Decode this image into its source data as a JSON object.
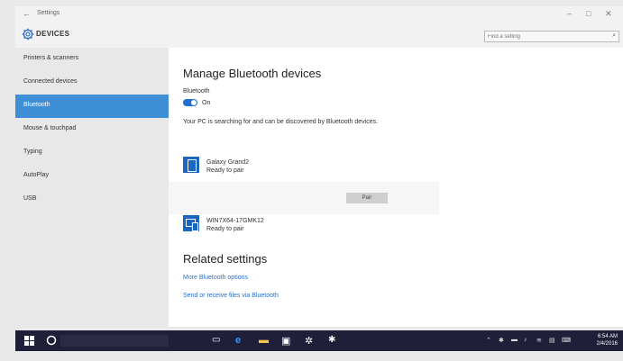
{
  "window": {
    "title": "Settings",
    "back_glyph": "←",
    "minimize_glyph": "–",
    "maximize_glyph": "□",
    "close_glyph": "✕"
  },
  "header": {
    "title": "DEVICES",
    "icon": "gear-icon",
    "search_placeholder": "Find a setting",
    "search_value": "",
    "search_icon_glyph": "⌕"
  },
  "sidebar": {
    "items": [
      {
        "label": "Printers & scanners",
        "active": false
      },
      {
        "label": "Connected devices",
        "active": false
      },
      {
        "label": "Bluetooth",
        "active": true
      },
      {
        "label": "Mouse & touchpad",
        "active": false
      },
      {
        "label": "Typing",
        "active": false
      },
      {
        "label": "AutoPlay",
        "active": false
      },
      {
        "label": "USB",
        "active": false
      }
    ]
  },
  "main": {
    "title": "Manage Bluetooth devices",
    "bluetooth_label": "Bluetooth",
    "toggle_state": "On",
    "status_text": "Your PC is searching for and can be discovered by Bluetooth devices.",
    "devices": [
      {
        "name": "Galaxy Grand2",
        "status": "Ready to pair",
        "icon": "phone-icon"
      },
      {
        "name": "WIN7X64-17GMK12",
        "status": "Ready to pair",
        "icon": "computer-icon"
      }
    ],
    "pair_label": "Pair",
    "related_title": "Related settings",
    "related_links": [
      "More Bluetooth options",
      "Send or receive files via Bluetooth"
    ]
  },
  "taskbar": {
    "start_icon": "windows-logo-icon",
    "search_icon": "cortana-icon",
    "pinned": [
      "task-view-icon",
      "edge-icon",
      "file-explorer-icon",
      "store-icon",
      "settings-icon",
      "bluetooth-icon"
    ],
    "tray": [
      "up-arrow-icon",
      "bluetooth-tray-icon",
      "network-icon",
      "volume-icon",
      "language-icon",
      "notifications-icon",
      "keyboard-icon"
    ],
    "time": "6:54 AM",
    "date": "2/4/2016"
  },
  "colors": {
    "accent": "#3e8fd6",
    "toggle_on": "#1f6fd0",
    "link": "#2a6fc8",
    "taskbar": "#1f1f3a"
  }
}
